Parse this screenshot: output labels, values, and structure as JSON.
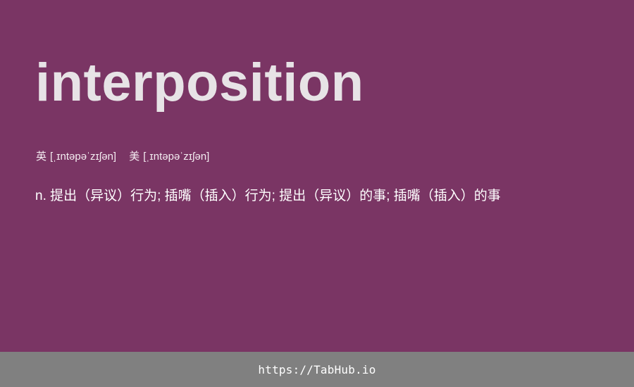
{
  "card": {
    "headword": "interposition",
    "phonetics": {
      "uk_label": "英",
      "uk_ipa": "[ˌɪntəpəˈzɪʃən]",
      "us_label": "美",
      "us_ipa": "[ˌɪntəpəˈzɪʃən]"
    },
    "definition": "n. 提出（异议）行为; 插嘴（插入）行为; 提出（异议）的事; 插嘴（插入）的事"
  },
  "footer": {
    "link_text": "https://TabHub.io"
  },
  "colors": {
    "background": "#7a3564",
    "headword": "#e7e3e6",
    "footer_bar": "#808080",
    "text": "#ffffff"
  }
}
